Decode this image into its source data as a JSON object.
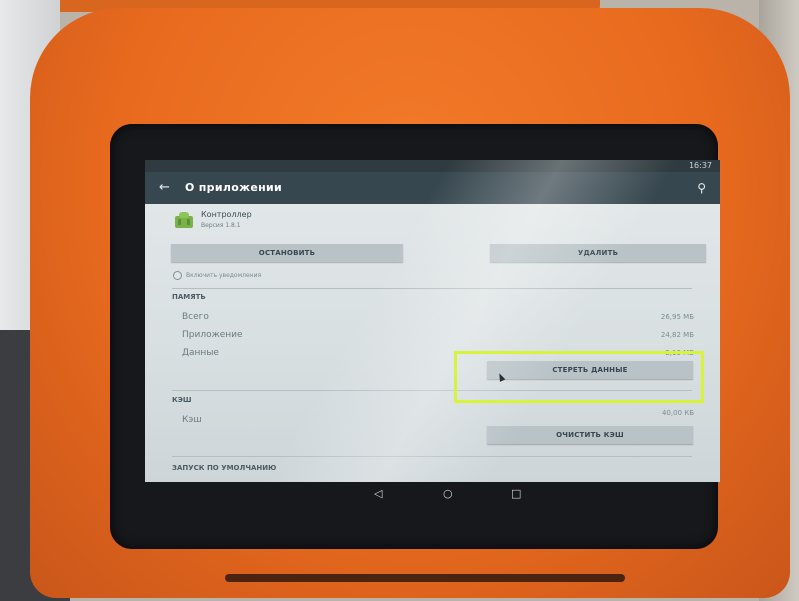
{
  "toolbar": {
    "title": "О приложении"
  },
  "app": {
    "name": "Контроллер",
    "version": "Версия 1.8.1"
  },
  "buttons": {
    "stop": "ОСТАНОВИТЬ",
    "delete": "УДАЛИТЬ",
    "clear_data": "СТЕРЕТЬ ДАННЫЕ",
    "clear_cache": "ОЧИСТИТЬ КЭШ"
  },
  "notifications": {
    "label": "Включить уведомления",
    "checked": false
  },
  "memory": {
    "title": "ПАМЯТЬ",
    "rows": [
      {
        "label": "Всего",
        "value": "26,95 МБ"
      },
      {
        "label": "Приложение",
        "value": "24,82 МБ"
      },
      {
        "label": "Данные",
        "value": "2,13 МБ"
      }
    ]
  },
  "cache": {
    "title": "КЭШ",
    "label": "Кэш",
    "value": "40,00 КБ"
  },
  "launch": {
    "title": "ЗАПУСК ПО УМОЛЧАНИЮ"
  },
  "status": {
    "time": "16:37"
  },
  "icons": {
    "back": "arrow-back-icon",
    "menu": "search-icon",
    "app": "android-app-icon",
    "nav_back": "triangle-back-icon",
    "nav_home": "circle-home-icon",
    "nav_recents": "square-recents-icon"
  },
  "colors": {
    "device_orange": "#e86a1e",
    "toolbar": "#37474f",
    "highlight": "#d7f43a",
    "button": "#b9c3c7"
  }
}
